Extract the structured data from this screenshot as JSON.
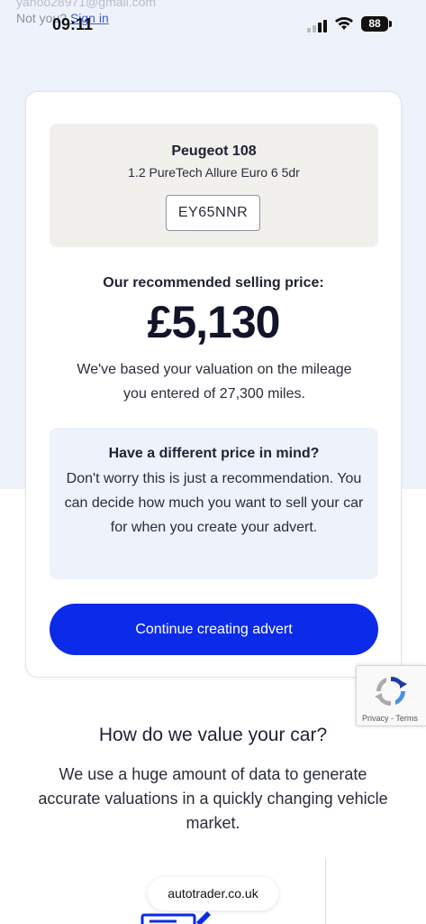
{
  "background_text": {
    "email_fragment": "yahoo28971@gmail.com",
    "not_you": "Not you?",
    "sign_in": "Sign in"
  },
  "status_bar": {
    "time": "09:11",
    "battery": "88"
  },
  "vehicle": {
    "make_model": "Peugeot 108",
    "variant": "1.2 PureTech Allure Euro 6 5dr",
    "registration": "EY65NNR"
  },
  "valuation": {
    "label": "Our recommended selling price:",
    "price": "£5,130",
    "basis": "We've based your valuation on the mileage you entered of 27,300 miles."
  },
  "info": {
    "title": "Have a different price in mind?",
    "body": "Don't worry this is just a recommendation. You can decide how much you want to sell your car for when you create your advert."
  },
  "actions": {
    "continue_label": "Continue creating advert"
  },
  "recaptcha": {
    "links": "Privacy - Terms"
  },
  "how_section": {
    "title": "How do we value your car?",
    "body": "We use a huge amount of data to generate accurate valuations in a quickly changing vehicle market."
  },
  "browser": {
    "url": "autotrader.co.uk"
  },
  "colors": {
    "primary_button": "#0c2be8",
    "band_background": "#eef2fb"
  }
}
